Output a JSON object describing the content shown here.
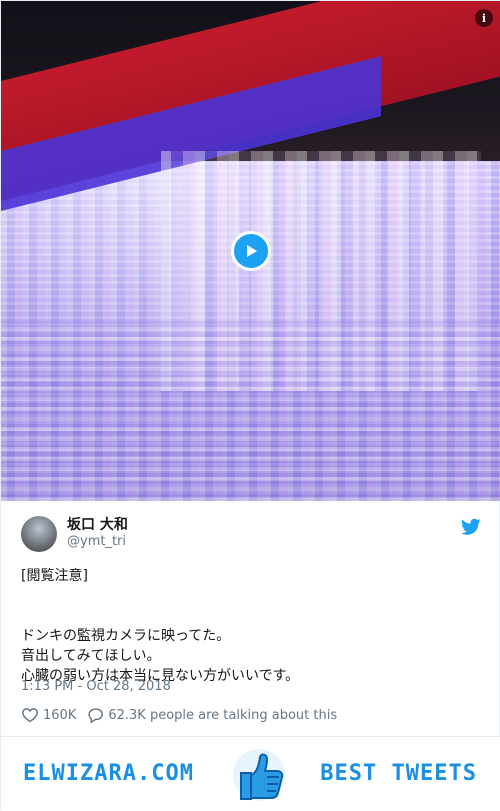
{
  "media": {
    "info_icon": "info-icon",
    "play_icon": "play-icon",
    "colors": {
      "play_button": "#1da1f2"
    }
  },
  "author": {
    "name": "坂口 大和",
    "handle": "@ymt_tri"
  },
  "tweet": {
    "lines_top": [
      "[閲覧注意]"
    ],
    "lines_bottom": [
      "ドンキの監視カメラに映ってた。",
      "音出してみてほしい。",
      "心臓の弱い方は本当に見ない方がいいです。"
    ],
    "timestamp": "1:13 PM - Oct 28, 2018"
  },
  "actions": {
    "likes": "160K",
    "talking": "62.3K people are talking about this"
  },
  "footer": {
    "left_brand": "ELWIZARA.COM",
    "right_brand": "BEST TWEETS",
    "brand_color": "#1a8fe3"
  }
}
